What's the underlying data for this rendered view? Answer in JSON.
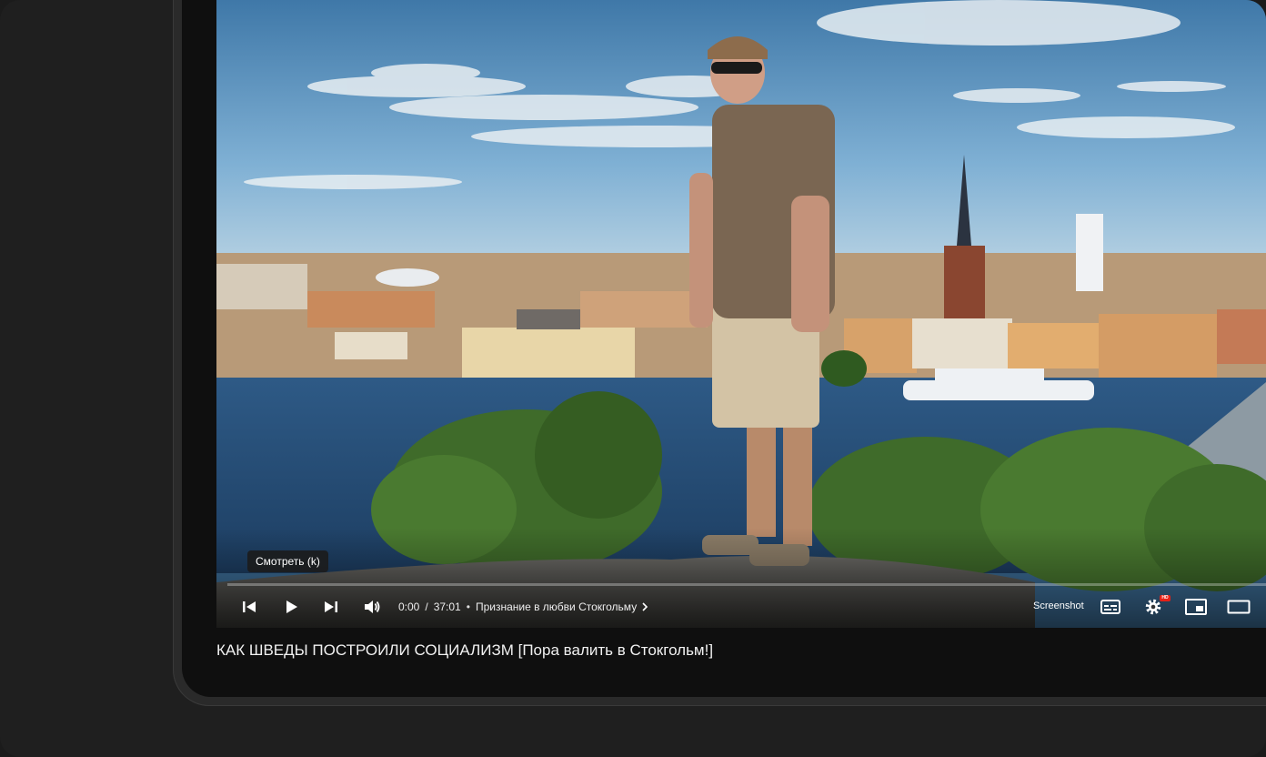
{
  "player": {
    "tooltip": "Смотреть (k)",
    "time_current": "0:00",
    "time_separator": "/",
    "time_total": "37:01",
    "chapter_title": "Признание в любви Стокгольму",
    "screenshot_label": "Screenshot",
    "hd_badge": "HD",
    "progress": 0.0
  },
  "video": {
    "title": "КАК ШВЕДЫ ПОСТРОИЛИ СОЦИАЛИЗМ [Пора валить в Стокгольм!]"
  },
  "icons": {
    "prev": "skip-previous-icon",
    "play": "play-icon",
    "next": "skip-next-icon",
    "volume": "volume-icon",
    "subtitles": "subtitles-icon",
    "settings": "gear-icon",
    "miniplayer": "miniplayer-icon",
    "theater": "theater-mode-icon"
  },
  "colors": {
    "background": "#1f1f1f",
    "hd_badge": "#e62117",
    "title_text": "#f1f1f1"
  }
}
